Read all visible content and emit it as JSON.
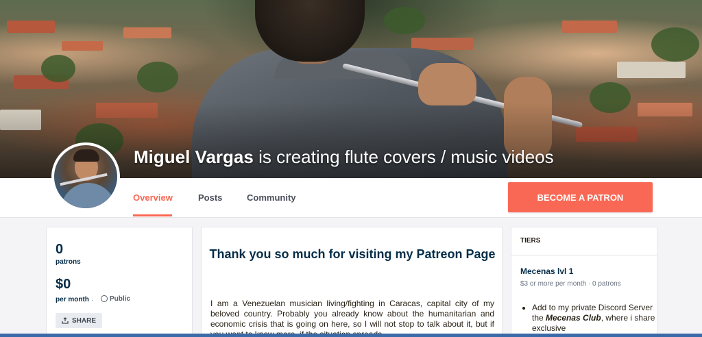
{
  "banner": {
    "creator_name": "Miguel Vargas",
    "tagline": " is creating flute covers / music videos"
  },
  "nav": {
    "tabs": [
      {
        "label": "Overview",
        "active": true
      },
      {
        "label": "Posts",
        "active": false
      },
      {
        "label": "Community",
        "active": false
      }
    ],
    "cta_label": "BECOME A PATRON"
  },
  "stats": {
    "patrons_value": "0",
    "patrons_label": "patrons",
    "amount_value": "$0",
    "amount_label": "per month",
    "separator": "·",
    "visibility": "Public",
    "share_label": "SHARE"
  },
  "about": {
    "title": "Thank you so much for visiting my  Patreon Page",
    "body": "I am a Venezuelan musician living/fighting in Caracas, capital city of my beloved country. Probably you already know about the humanitarian and economic crisis that is going on here, so I will not stop to talk about it, but if you want to know more, if the situation spreads..."
  },
  "tiers": {
    "header": "TIERS",
    "items": [
      {
        "name": "Mecenas lvl 1",
        "price_line": "$3 or more per month · 0 patrons",
        "benefit_prefix": "Add to my private Discord Server the ",
        "benefit_emph": "Mecenas Club",
        "benefit_suffix": ", where i share exclusive"
      }
    ]
  },
  "colors": {
    "accent": "#f96854",
    "navy": "#052d49"
  }
}
